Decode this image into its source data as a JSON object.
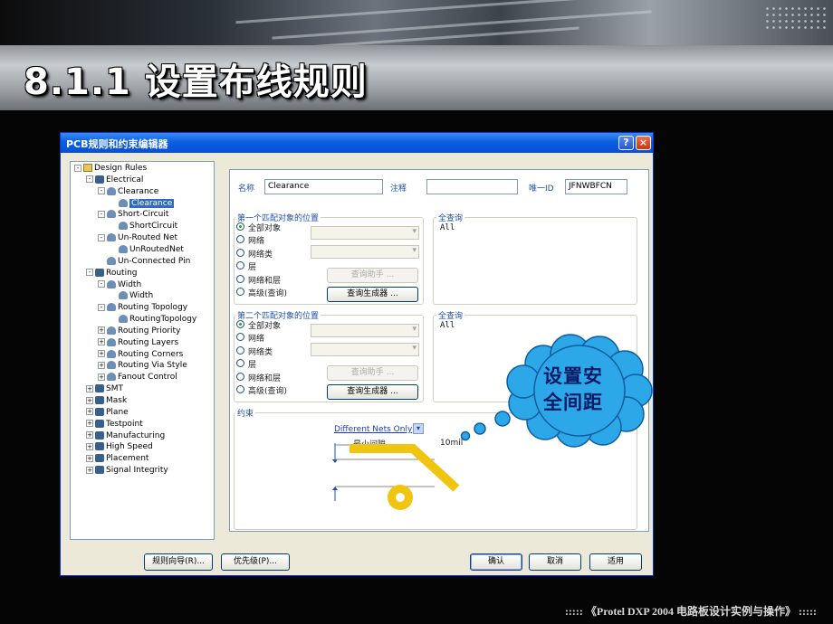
{
  "slide": {
    "title": "8.1.1  设置布线规则",
    "footer": "::::: 《Protel DXP 2004 电路板设计实例与操作》 :::::"
  },
  "dialog": {
    "title": "PCB规则和约束编辑器",
    "help_label": "?",
    "close_label": "×",
    "tree": [
      {
        "label": "Design Rules",
        "level": 0,
        "expander": "-",
        "icon": "folder-icon"
      },
      {
        "label": "Electrical",
        "level": 1,
        "expander": "-",
        "icon": "rule-group-icon"
      },
      {
        "label": "Clearance",
        "level": 2,
        "expander": "-",
        "icon": "rule-icon"
      },
      {
        "label": "Clearance",
        "level": 3,
        "expander": "",
        "icon": "rule-icon",
        "selected": true
      },
      {
        "label": "Short-Circuit",
        "level": 2,
        "expander": "-",
        "icon": "rule-icon"
      },
      {
        "label": "ShortCircuit",
        "level": 3,
        "expander": "",
        "icon": "rule-icon"
      },
      {
        "label": "Un-Routed Net",
        "level": 2,
        "expander": "-",
        "icon": "rule-icon"
      },
      {
        "label": "UnRoutedNet",
        "level": 3,
        "expander": "",
        "icon": "rule-icon"
      },
      {
        "label": "Un-Connected Pin",
        "level": 2,
        "expander": "",
        "icon": "rule-icon"
      },
      {
        "label": "Routing",
        "level": 1,
        "expander": "-",
        "icon": "rule-group-icon"
      },
      {
        "label": "Width",
        "level": 2,
        "expander": "-",
        "icon": "rule-icon"
      },
      {
        "label": "Width",
        "level": 3,
        "expander": "",
        "icon": "rule-icon"
      },
      {
        "label": "Routing Topology",
        "level": 2,
        "expander": "-",
        "icon": "rule-icon"
      },
      {
        "label": "RoutingTopology",
        "level": 3,
        "expander": "",
        "icon": "rule-icon"
      },
      {
        "label": "Routing Priority",
        "level": 2,
        "expander": "+",
        "icon": "rule-icon"
      },
      {
        "label": "Routing Layers",
        "level": 2,
        "expander": "+",
        "icon": "rule-icon"
      },
      {
        "label": "Routing Corners",
        "level": 2,
        "expander": "+",
        "icon": "rule-icon"
      },
      {
        "label": "Routing Via Style",
        "level": 2,
        "expander": "+",
        "icon": "rule-icon"
      },
      {
        "label": "Fanout Control",
        "level": 2,
        "expander": "+",
        "icon": "rule-icon"
      },
      {
        "label": "SMT",
        "level": 1,
        "expander": "+",
        "icon": "rule-group-icon"
      },
      {
        "label": "Mask",
        "level": 1,
        "expander": "+",
        "icon": "rule-group-icon"
      },
      {
        "label": "Plane",
        "level": 1,
        "expander": "+",
        "icon": "rule-group-icon"
      },
      {
        "label": "Testpoint",
        "level": 1,
        "expander": "+",
        "icon": "rule-group-icon"
      },
      {
        "label": "Manufacturing",
        "level": 1,
        "expander": "+",
        "icon": "rule-group-icon"
      },
      {
        "label": "High Speed",
        "level": 1,
        "expander": "+",
        "icon": "rule-group-icon"
      },
      {
        "label": "Placement",
        "level": 1,
        "expander": "+",
        "icon": "rule-group-icon"
      },
      {
        "label": "Signal Integrity",
        "level": 1,
        "expander": "+",
        "icon": "rule-group-icon"
      }
    ],
    "header": {
      "name_label": "名称",
      "name_value": "Clearance",
      "comment_label": "注释",
      "comment_value": "",
      "unique_id_label": "唯一ID",
      "unique_id_value": "JFNWBFCN"
    },
    "first_match": {
      "title": "第一个匹配对象的位置",
      "options": [
        "全部对象",
        "网络",
        "网络类",
        "层",
        "网络和层",
        "高级(查询)"
      ],
      "selected": 0,
      "query_helper": "查询助手 ...",
      "query_builder": "查询生成器 ...",
      "full_query_title": "全查询",
      "full_query_text": "All"
    },
    "second_match": {
      "title": "第二个匹配对象的位置",
      "options": [
        "全部对象",
        "网络",
        "网络类",
        "层",
        "网络和层",
        "高级(查询)"
      ],
      "selected": 0,
      "query_helper": "查询助手 ...",
      "query_builder": "查询生成器 ...",
      "full_query_title": "全查询",
      "full_query_text": "All"
    },
    "constraints": {
      "title": "约束",
      "net_scope": "Different Nets Only",
      "min_clearance_label": "最小间隙",
      "min_clearance_value": "10mil"
    },
    "buttons": {
      "rule_wizard": "规则向导(R)...",
      "priorities": "优先级(P)...",
      "ok": "确认",
      "cancel": "取消",
      "apply": "适用"
    }
  },
  "callout": {
    "text_line1": "设置安",
    "text_line2": "全间距",
    "color": "#2ca7e8"
  }
}
